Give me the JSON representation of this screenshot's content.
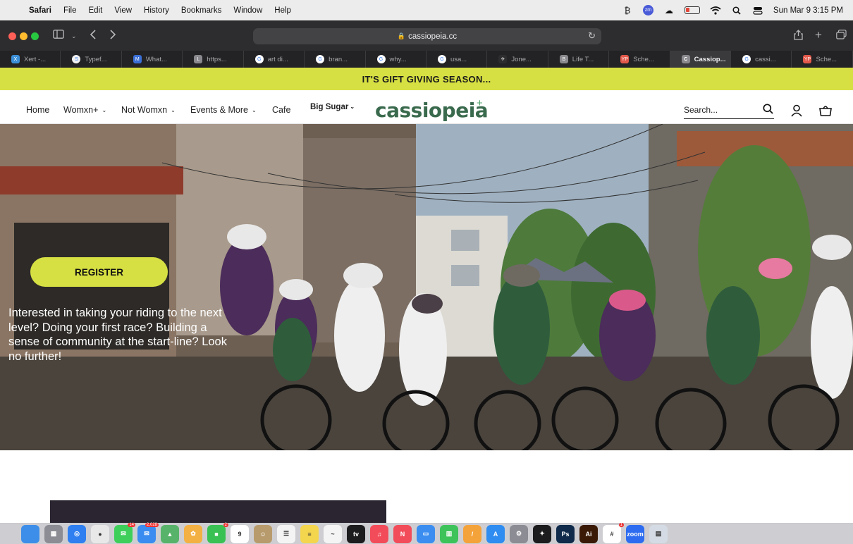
{
  "menubar": {
    "app": "Safari",
    "items": [
      "File",
      "Edit",
      "View",
      "History",
      "Bookmarks",
      "Window",
      "Help"
    ],
    "datetime": "Sun Mar 9  3:15 PM",
    "zoom_label": "zm"
  },
  "browser": {
    "url": "cassiopeia.cc",
    "tabs": [
      {
        "label": "Xert -...",
        "fav": "#3c8fd8",
        "glyph": "X"
      },
      {
        "label": "Typef...",
        "fav": "#f0f0f0",
        "glyph": "S"
      },
      {
        "label": "What...",
        "fav": "#3b6fd6",
        "glyph": "M"
      },
      {
        "label": "https...",
        "fav": "#8a8a8e",
        "glyph": "L"
      },
      {
        "label": "art di...",
        "fav": "#ffffff",
        "glyph": "G"
      },
      {
        "label": "bran...",
        "fav": "#ffffff",
        "glyph": "G"
      },
      {
        "label": "why...",
        "fav": "#ffffff",
        "glyph": "G"
      },
      {
        "label": "usa...",
        "fav": "#ffffff",
        "glyph": "G"
      },
      {
        "label": "Jone...",
        "fav": "#2d2d2f",
        "glyph": "✈"
      },
      {
        "label": "Life T...",
        "fav": "#8a8a8e",
        "glyph": "B"
      },
      {
        "label": "Sche...",
        "fav": "#e2584a",
        "glyph": "YP"
      },
      {
        "label": "Cassiop...",
        "fav": "#8a8a8e",
        "glyph": "C",
        "active": true
      },
      {
        "label": "cassi...",
        "fav": "#ffffff",
        "glyph": "G"
      },
      {
        "label": "Sche...",
        "fav": "#e2584a",
        "glyph": "YP"
      }
    ]
  },
  "announcement": "IT'S GIFT GIVING SEASON...",
  "header": {
    "nav": [
      {
        "label": "Home",
        "dropdown": false
      },
      {
        "label": "Womxn+",
        "dropdown": true
      },
      {
        "label": "Not Womxn",
        "dropdown": true
      },
      {
        "label": "Events & More",
        "dropdown": true
      },
      {
        "label": "Cafe",
        "dropdown": false
      },
      {
        "label": "Big Sugar",
        "dropdown": true
      }
    ],
    "logo": "cassiopeia",
    "search_placeholder": "Search..."
  },
  "hero": {
    "button": "REGISTER",
    "text": "Interested in taking your riding to the next level? Doing your first race? Building a sense of community at the start-line? Look no further!"
  },
  "dock": {
    "apps": [
      {
        "name": "finder",
        "color": "#3d8ee8",
        "glyph": ""
      },
      {
        "name": "launchpad",
        "color": "#8c8c94",
        "glyph": "▦"
      },
      {
        "name": "safari",
        "color": "#2f7ff0",
        "glyph": "◎"
      },
      {
        "name": "chrome",
        "color": "#e8e8e8",
        "glyph": "●"
      },
      {
        "name": "messages",
        "color": "#3ecf5b",
        "glyph": "✉",
        "badge": "14"
      },
      {
        "name": "mail",
        "color": "#3a8cf0",
        "glyph": "✉",
        "badge": "2,028"
      },
      {
        "name": "maps",
        "color": "#58b36a",
        "glyph": "▲"
      },
      {
        "name": "photos",
        "color": "#f3b043",
        "glyph": "✿"
      },
      {
        "name": "facetime",
        "color": "#39c153",
        "glyph": "■",
        "badge": "2"
      },
      {
        "name": "calendar",
        "color": "#ffffff",
        "glyph": "9"
      },
      {
        "name": "contacts",
        "color": "#b89b6c",
        "glyph": "☺"
      },
      {
        "name": "reminders",
        "color": "#f4f4f4",
        "glyph": "☰"
      },
      {
        "name": "notes",
        "color": "#f4d54e",
        "glyph": "≡"
      },
      {
        "name": "freeform",
        "color": "#f4f4f4",
        "glyph": "~"
      },
      {
        "name": "apple-tv",
        "color": "#1c1c1e",
        "glyph": "tv"
      },
      {
        "name": "music",
        "color": "#f24c5a",
        "glyph": "♫"
      },
      {
        "name": "news",
        "color": "#f24c5a",
        "glyph": "N"
      },
      {
        "name": "keynote",
        "color": "#3b8ef0",
        "glyph": "▭"
      },
      {
        "name": "numbers",
        "color": "#3ec35a",
        "glyph": "▥"
      },
      {
        "name": "pages",
        "color": "#f4a23a",
        "glyph": "/"
      },
      {
        "name": "app-store",
        "color": "#2f8cf0",
        "glyph": "A"
      },
      {
        "name": "system-settings",
        "color": "#8c8c94",
        "glyph": "⚙"
      },
      {
        "name": "figma",
        "color": "#1c1c1e",
        "glyph": "✦"
      },
      {
        "name": "photoshop",
        "color": "#0f2a4a",
        "glyph": "Ps"
      },
      {
        "name": "illustrator",
        "color": "#3a1a06",
        "glyph": "Ai"
      },
      {
        "name": "slack",
        "color": "#ffffff",
        "glyph": "#",
        "badge": "1"
      },
      {
        "name": "zoom",
        "color": "#2d6cf0",
        "glyph": "zoom"
      },
      {
        "name": "preview",
        "color": "#d4dbe4",
        "glyph": "▤"
      }
    ]
  }
}
